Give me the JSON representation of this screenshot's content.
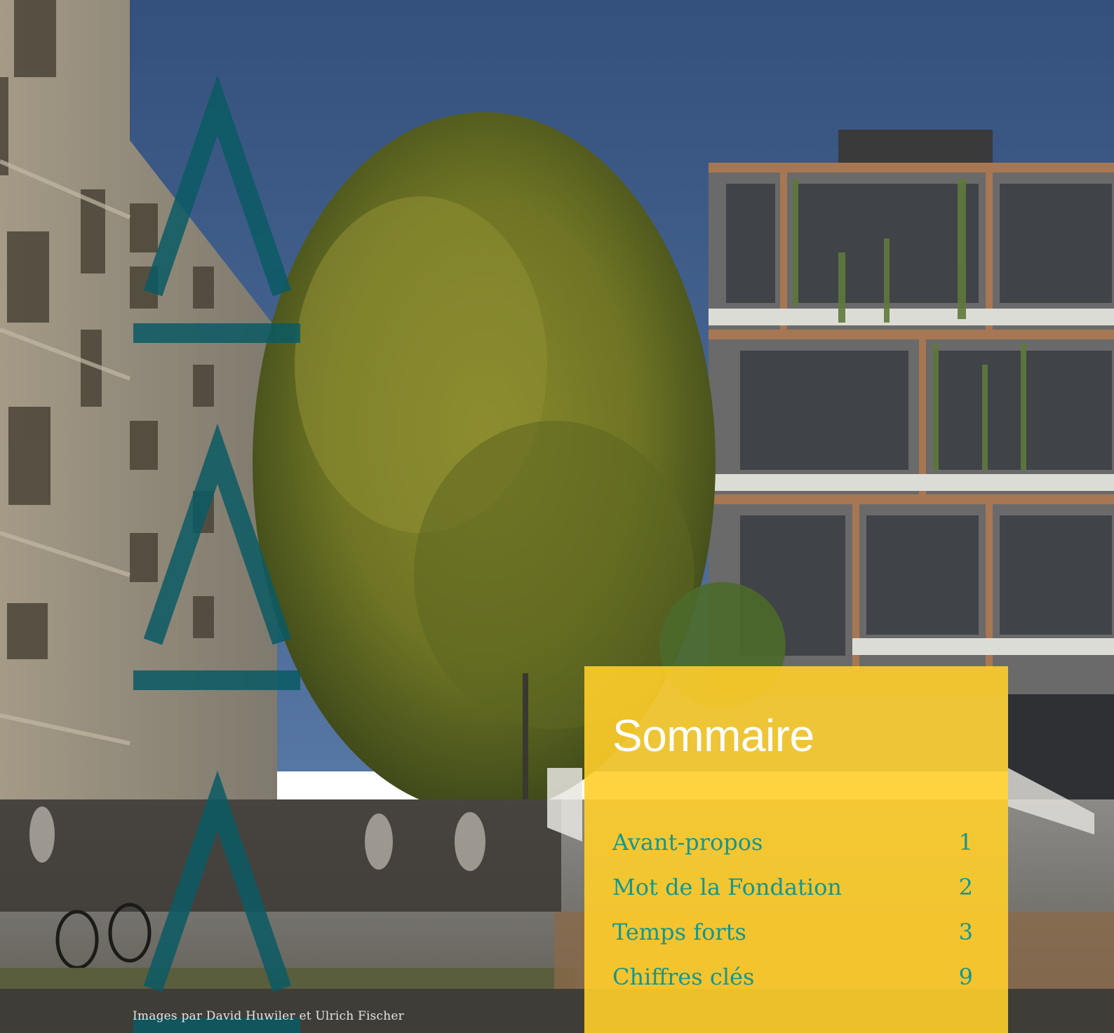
{
  "credit": "Images par David Huwiler et Ulrich Fischer",
  "summary": {
    "title": "Sommaire",
    "items": [
      {
        "label": "Avant-propos",
        "page": "1"
      },
      {
        "label": "Mot de la Fondation",
        "page": "2"
      },
      {
        "label": "Temps forts",
        "page": "3"
      },
      {
        "label": "Chiffres clés",
        "page": "9"
      }
    ]
  },
  "colors": {
    "panel": "#ffce2a",
    "toc_text": "#14968f",
    "title_text": "#ffffff",
    "logo_stroke": "#0a5a64",
    "sky": "#3d5e8c"
  },
  "icons": [
    "logo-mark-icon"
  ]
}
